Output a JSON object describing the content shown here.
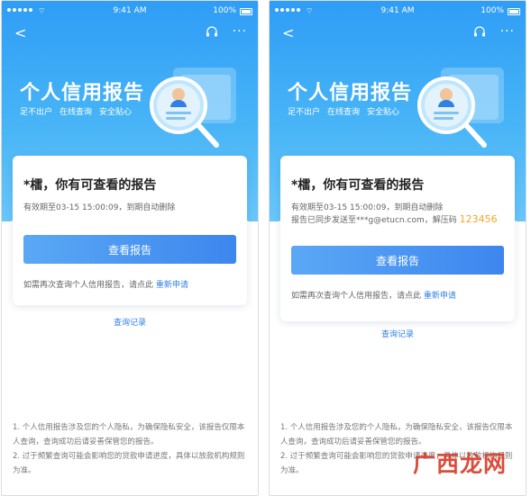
{
  "status": {
    "time": "9:41 AM",
    "battery": "100%"
  },
  "hero": {
    "title": "个人信用报告",
    "tags": [
      "足不出户",
      "在线查询",
      "安全贴心"
    ]
  },
  "card": {
    "title": "*檑，你有可查看的报告",
    "validity": "有效期至03-15 15:00:09，到期自动删除",
    "email_text": "报告已同步发送至***g@etucn.com，解压码",
    "unzip_code": "123456",
    "view_button": "查看报告",
    "requery_text": "如需再次查询个人信用报告，请点此",
    "requery_link": "重新申请"
  },
  "history_link": "查询记录",
  "notes": [
    "1. 个人信用报告涉及您的个人隐私，为确保隐私安全，该报告仅限本人查询，查询成功后请妥善保管您的报告。",
    "2. 过于频繁查询可能会影响您的贷款申请进度，具体以放款机构规则为准。"
  ],
  "watermark": "广西龙网",
  "colors": {
    "hero_top": "#2f9df6",
    "hero_bottom": "#69c6f8",
    "link": "#2f7fe6",
    "code": "#f5a623",
    "watermark": "#d93e2b"
  },
  "icons": [
    "back-icon",
    "headset-icon",
    "more-icon",
    "report-magnifier-illustration"
  ]
}
